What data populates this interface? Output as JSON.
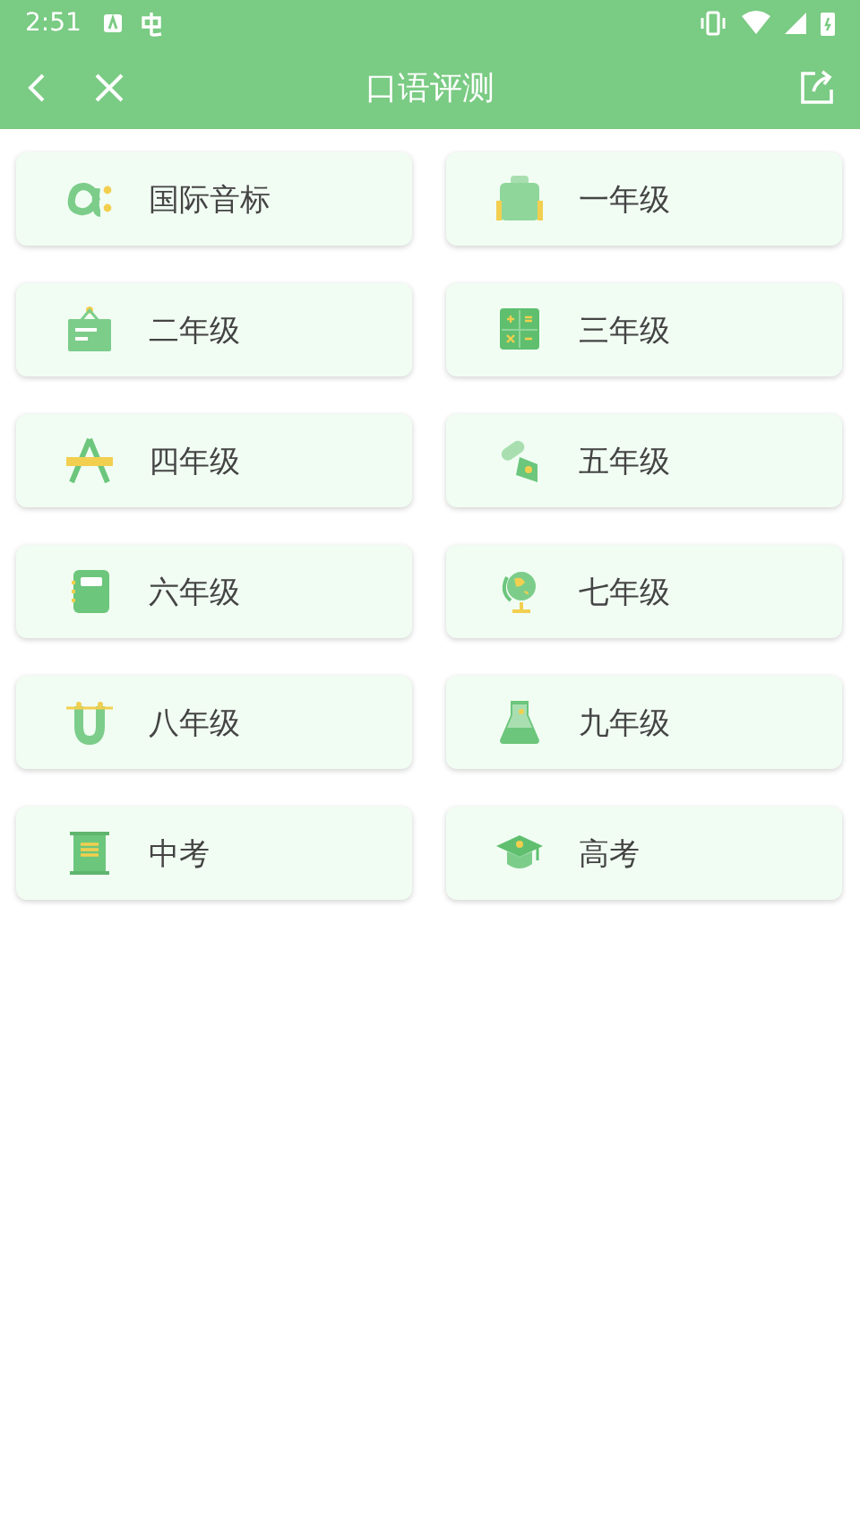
{
  "status_bar": {
    "time": "2:51"
  },
  "toolbar": {
    "title": "口语评测"
  },
  "categories": [
    {
      "label": "国际音标"
    },
    {
      "label": "一年级"
    },
    {
      "label": "二年级"
    },
    {
      "label": "三年级"
    },
    {
      "label": "四年级"
    },
    {
      "label": "五年级"
    },
    {
      "label": "六年级"
    },
    {
      "label": "七年级"
    },
    {
      "label": "八年级"
    },
    {
      "label": "九年级"
    },
    {
      "label": "中考"
    },
    {
      "label": "高考"
    }
  ]
}
